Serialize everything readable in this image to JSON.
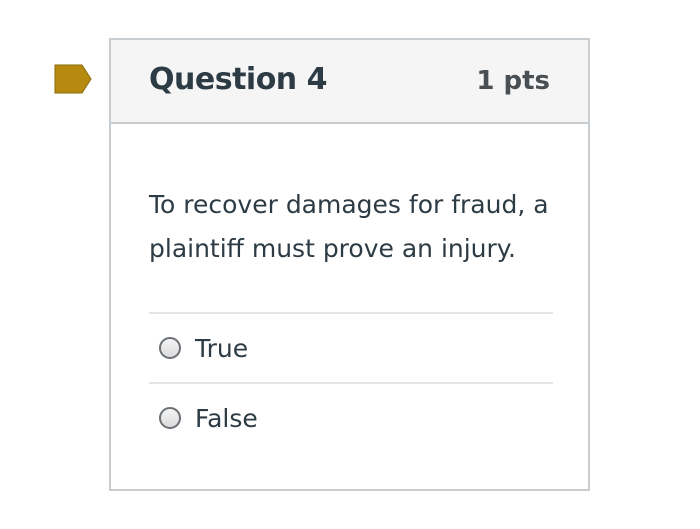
{
  "question": {
    "title": "Question 4",
    "points": "1 pts",
    "text": "To recover damages for fraud, a plaintiff must prove an injury.",
    "flag_icon": "bookmark-flag-icon",
    "flag_color": "#b58a0f",
    "answers": [
      {
        "label": "True",
        "selected": false
      },
      {
        "label": "False",
        "selected": false
      }
    ]
  }
}
